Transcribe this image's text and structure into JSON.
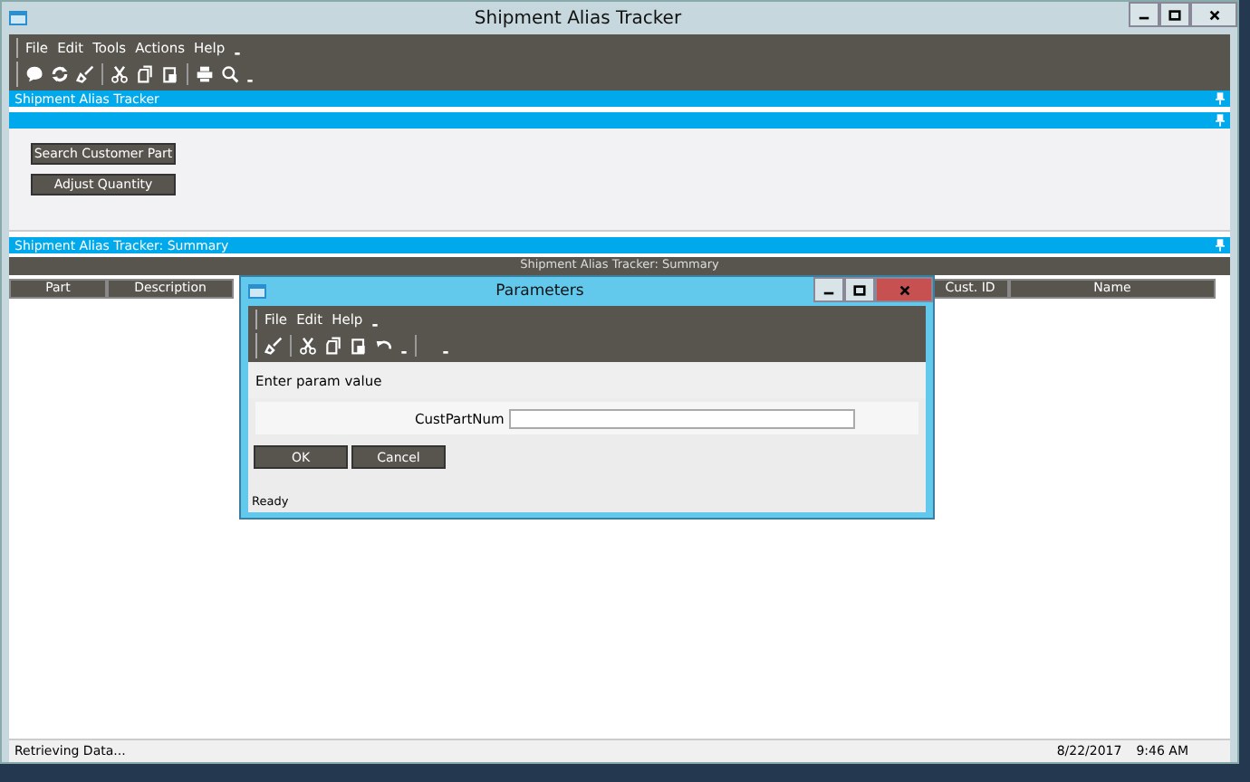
{
  "window": {
    "title": "Shipment Alias Tracker"
  },
  "menu": [
    "File",
    "Edit",
    "Tools",
    "Actions",
    "Help"
  ],
  "panel": {
    "title": "Shipment Alias Tracker",
    "buttons": [
      "Search Customer Part",
      "Adjust Quantity"
    ]
  },
  "summary": {
    "title": "Shipment Alias Tracker: Summary",
    "grid_title": "Shipment Alias Tracker: Summary",
    "columns": [
      "Part",
      "Description",
      "Cust. ID",
      "Name"
    ]
  },
  "status_bar": {
    "message": "Retrieving Data...",
    "date": "8/22/2017",
    "time": "9:46 AM"
  },
  "dialog": {
    "title": "Parameters",
    "menu": [
      "File",
      "Edit",
      "Help"
    ],
    "prompt": "Enter param value",
    "field_label": "CustPartNum",
    "buttons": [
      "OK",
      "Cancel"
    ],
    "status": "Ready"
  }
}
